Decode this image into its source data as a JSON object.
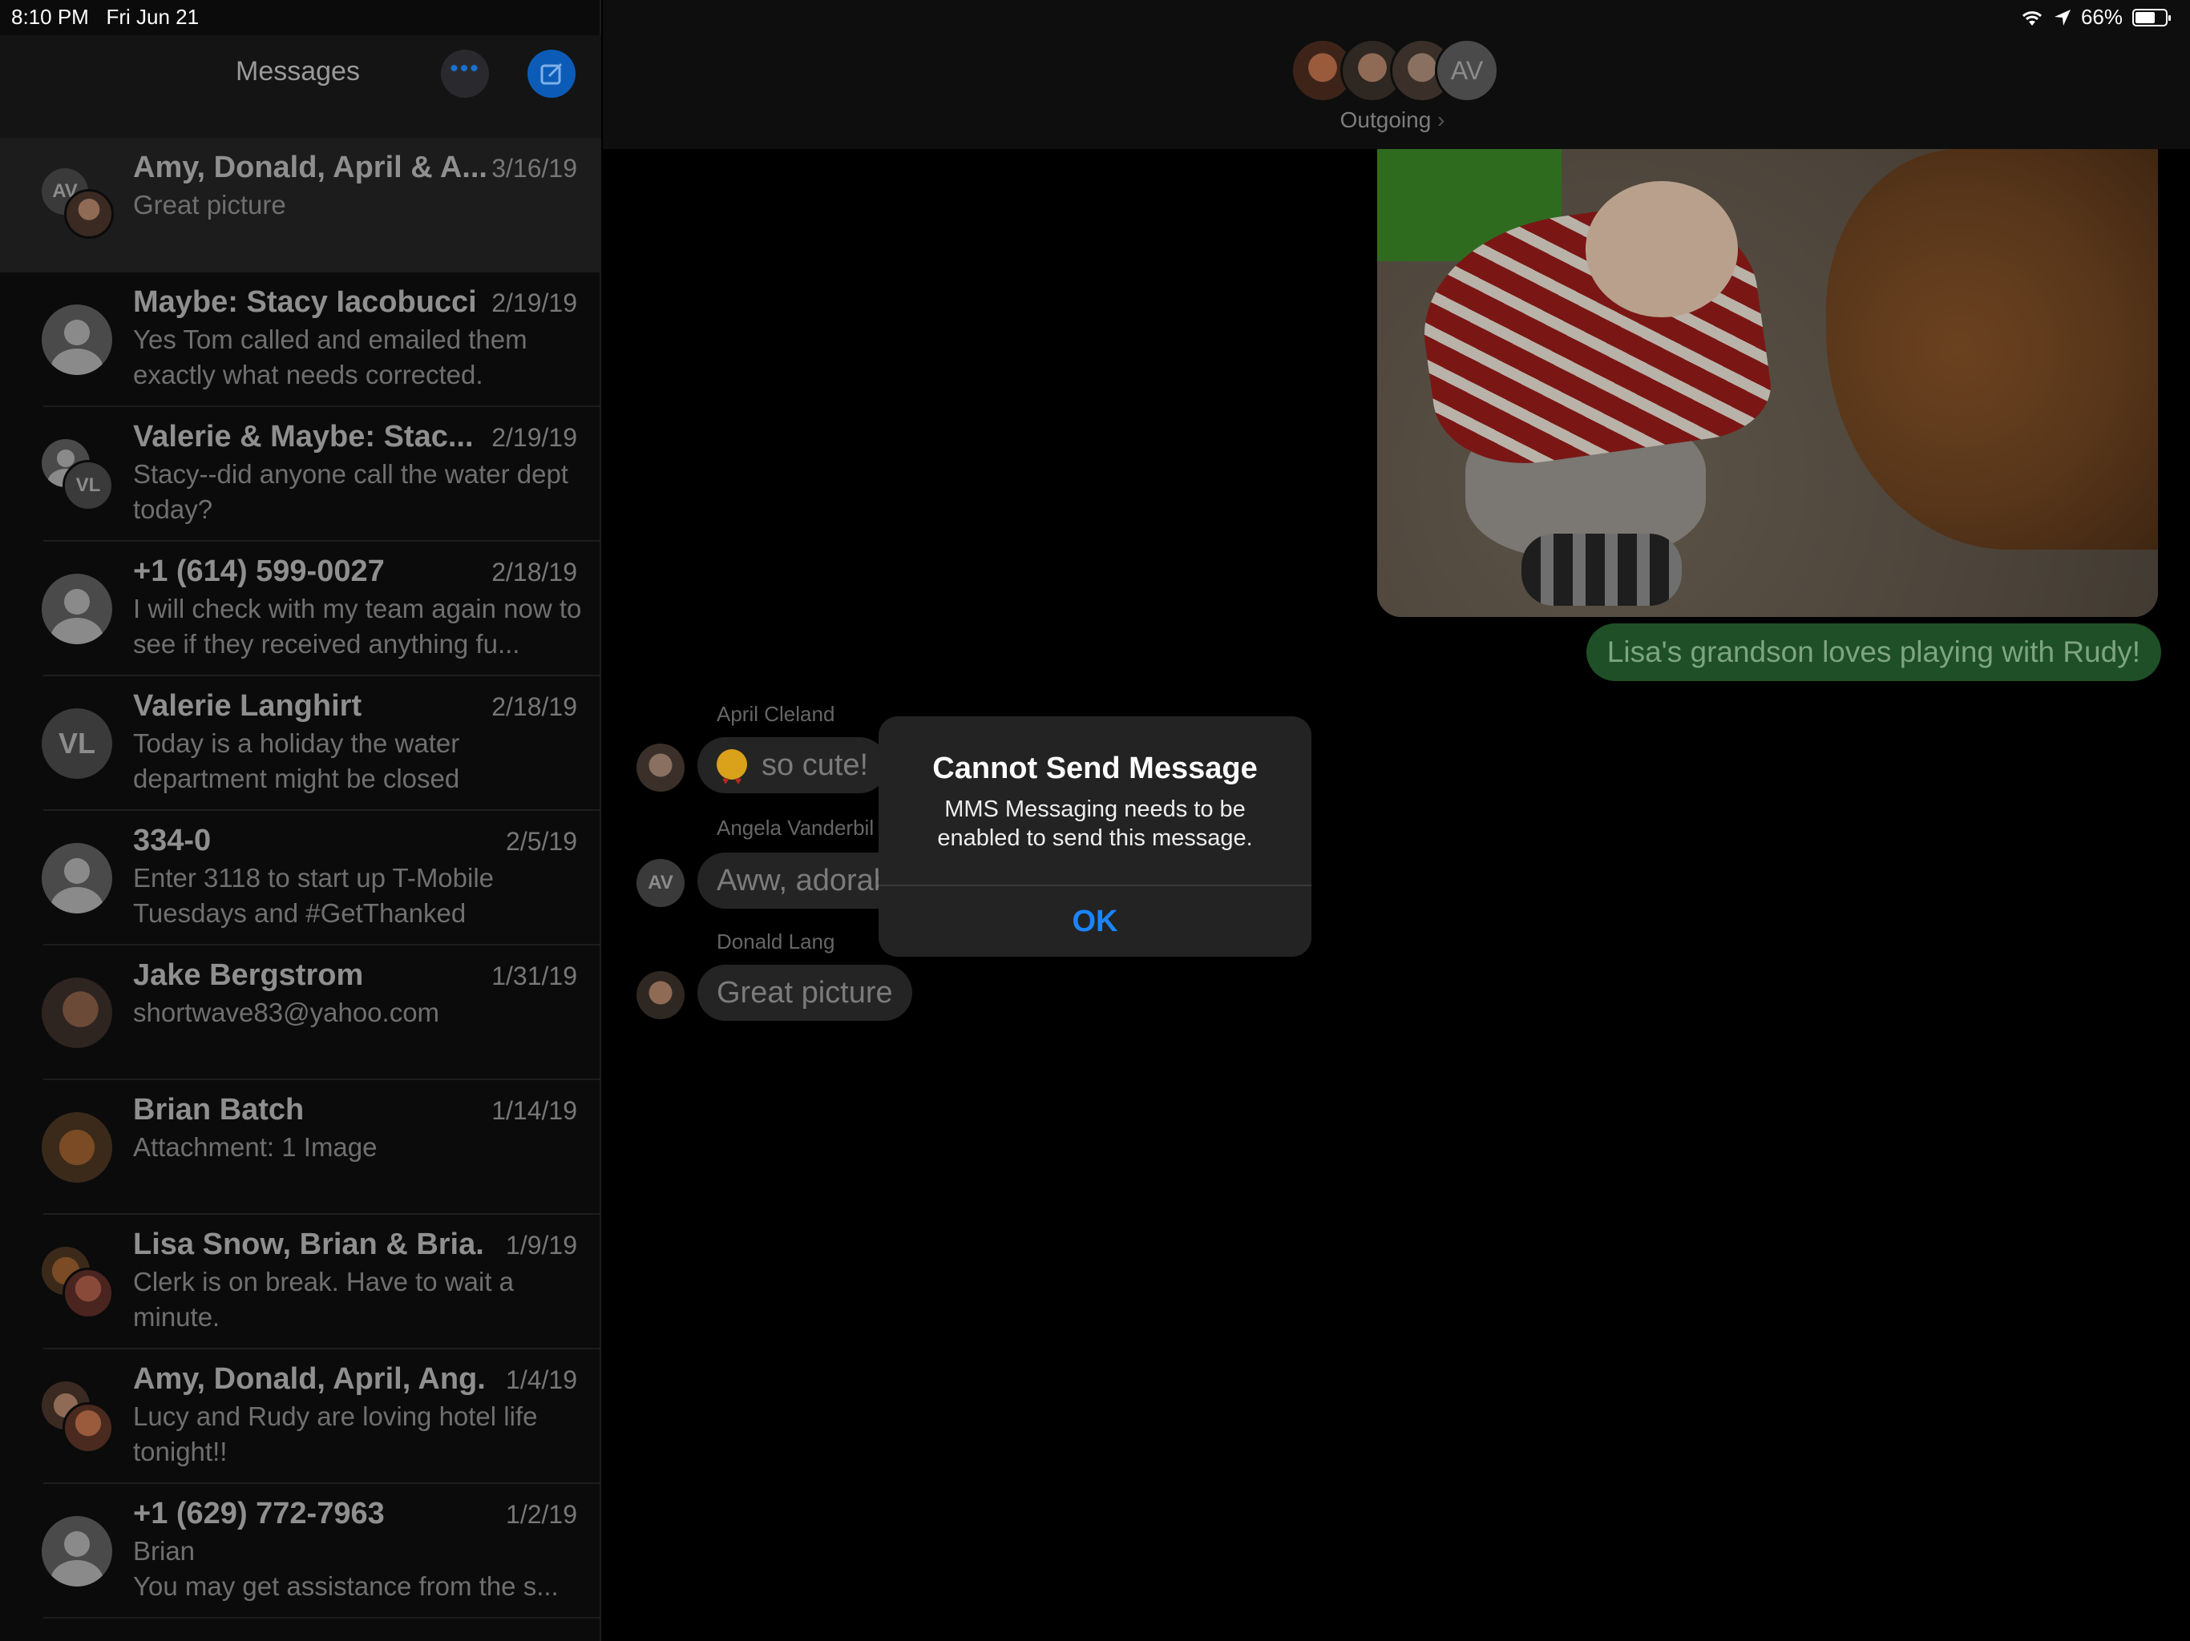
{
  "status": {
    "time": "8:10 PM",
    "date": "Fri Jun 21",
    "battery": "66%",
    "battery_level": 0.66
  },
  "sidebar": {
    "title": "Messages",
    "more_label": "•••",
    "conversations": [
      {
        "name": "Amy, Donald, April & A...",
        "date": "3/16/19",
        "preview": "Great picture",
        "avatar": "group",
        "initials": "AV",
        "selected": true
      },
      {
        "name": "Maybe: Stacy Iacobucci",
        "date": "2/19/19",
        "preview": "Yes Tom called and emailed them exactly what needs corrected.",
        "avatar": "generic"
      },
      {
        "name": "Valerie & Maybe: Stac...",
        "date": "2/19/19",
        "preview": "Stacy--did anyone call the water dept today?",
        "avatar": "group-vl",
        "initials": "VL"
      },
      {
        "name": "+1 (614) 599-0027",
        "date": "2/18/19",
        "preview": "I will check with my team again now to see if they received anything fu...",
        "avatar": "generic"
      },
      {
        "name": "Valerie Langhirt",
        "date": "2/18/19",
        "preview": "Today is a holiday the water department might be closed",
        "avatar": "initials",
        "initials": "VL"
      },
      {
        "name": "334-0",
        "date": "2/5/19",
        "preview": "Enter 3118 to start up T-Mobile Tuesdays and #GetThanked",
        "avatar": "generic"
      },
      {
        "name": "Jake Bergstrom",
        "date": "1/31/19",
        "preview": "shortwave83@yahoo.com",
        "avatar": "photo"
      },
      {
        "name": "Brian Batch",
        "date": "1/14/19",
        "preview": "Attachment: 1 Image",
        "avatar": "photo-dog"
      },
      {
        "name": "Lisa Snow, Brian & Bria...",
        "date": "1/9/19",
        "preview": "Clerk is on break. Have to wait a minute.",
        "avatar": "group-photo"
      },
      {
        "name": "Amy, Donald, April, Ang...",
        "date": "1/4/19",
        "preview": "Lucy and Rudy are loving hotel life tonight!!",
        "avatar": "group-photo"
      },
      {
        "name": "+1 (629) 772-7963",
        "date": "1/2/19",
        "preview": " Brian\nYou may get assistance from the s...",
        "avatar": "generic"
      }
    ]
  },
  "chat": {
    "title": "Outgoing",
    "title_chevron": "›",
    "header_initials": "AV",
    "outgoing_text": "Lisa's grandson loves playing with Rudy!",
    "messages": [
      {
        "sender": "April Cleland",
        "text": "so cute!",
        "emoji": "heart-eyes"
      },
      {
        "sender": "Angela Vanderbil",
        "text": "Aww, adorab",
        "initials": "AV"
      },
      {
        "sender": "Donald Lang",
        "text": "Great picture"
      }
    ]
  },
  "alert": {
    "title": "Cannot Send Message",
    "message": "MMS Messaging needs to be enabled to send this message.",
    "button": "OK"
  },
  "colors": {
    "accent": "#1a84ff",
    "outgoing_bubble": "#1f4f26",
    "incoming_bubble": "#242424"
  }
}
